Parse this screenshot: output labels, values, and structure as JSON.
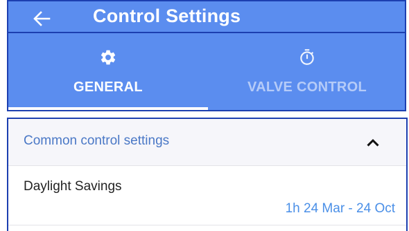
{
  "app_bar": {
    "title": "Control Settings",
    "back_icon": "arrow-left-icon",
    "background_color": "#5b8def",
    "outline_color": "#1c3fb0"
  },
  "tabs": [
    {
      "label": "GENERAL",
      "icon": "gear-icon",
      "selected": true
    },
    {
      "label": "VALVE CONTROL",
      "icon": "stopwatch-icon",
      "selected": false
    }
  ],
  "section": {
    "title": "Common control settings",
    "expanded": true,
    "toggle_icon": "chevron-up-icon",
    "title_color": "#4a78c6"
  },
  "settings": [
    {
      "label": "Daylight Savings",
      "value": "1h 24 Mar - 24 Oct",
      "value_color": "#4a8fe7"
    }
  ]
}
